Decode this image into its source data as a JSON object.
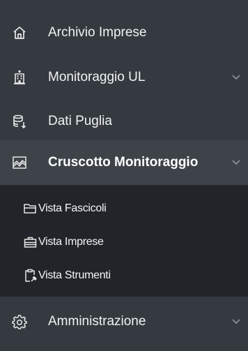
{
  "sidebar": {
    "items": [
      {
        "label": "Archivio Imprese",
        "icon": "home-icon",
        "has_chevron": false
      },
      {
        "label": "Monitoraggio UL",
        "icon": "building-icon",
        "has_chevron": true
      },
      {
        "label": "Dati Puglia",
        "icon": "database-icon",
        "has_chevron": false
      },
      {
        "label": "Cruscotto Monitoraggio",
        "icon": "chart-area-icon",
        "has_chevron": true,
        "active": true
      },
      {
        "label": "Amministrazione",
        "icon": "gear-icon",
        "has_chevron": true
      }
    ],
    "submenu": [
      {
        "label": "Vista Fascicoli",
        "icon": "folder-icon"
      },
      {
        "label": "Vista Imprese",
        "icon": "briefcase-icon"
      },
      {
        "label": "Vista Strumenti",
        "icon": "clipboard-tool-icon"
      }
    ]
  },
  "colors": {
    "sidebar_bg": "#343a40",
    "submenu_bg": "#212529",
    "active_bg": "#3d4349",
    "text": "#f2f2f2"
  }
}
